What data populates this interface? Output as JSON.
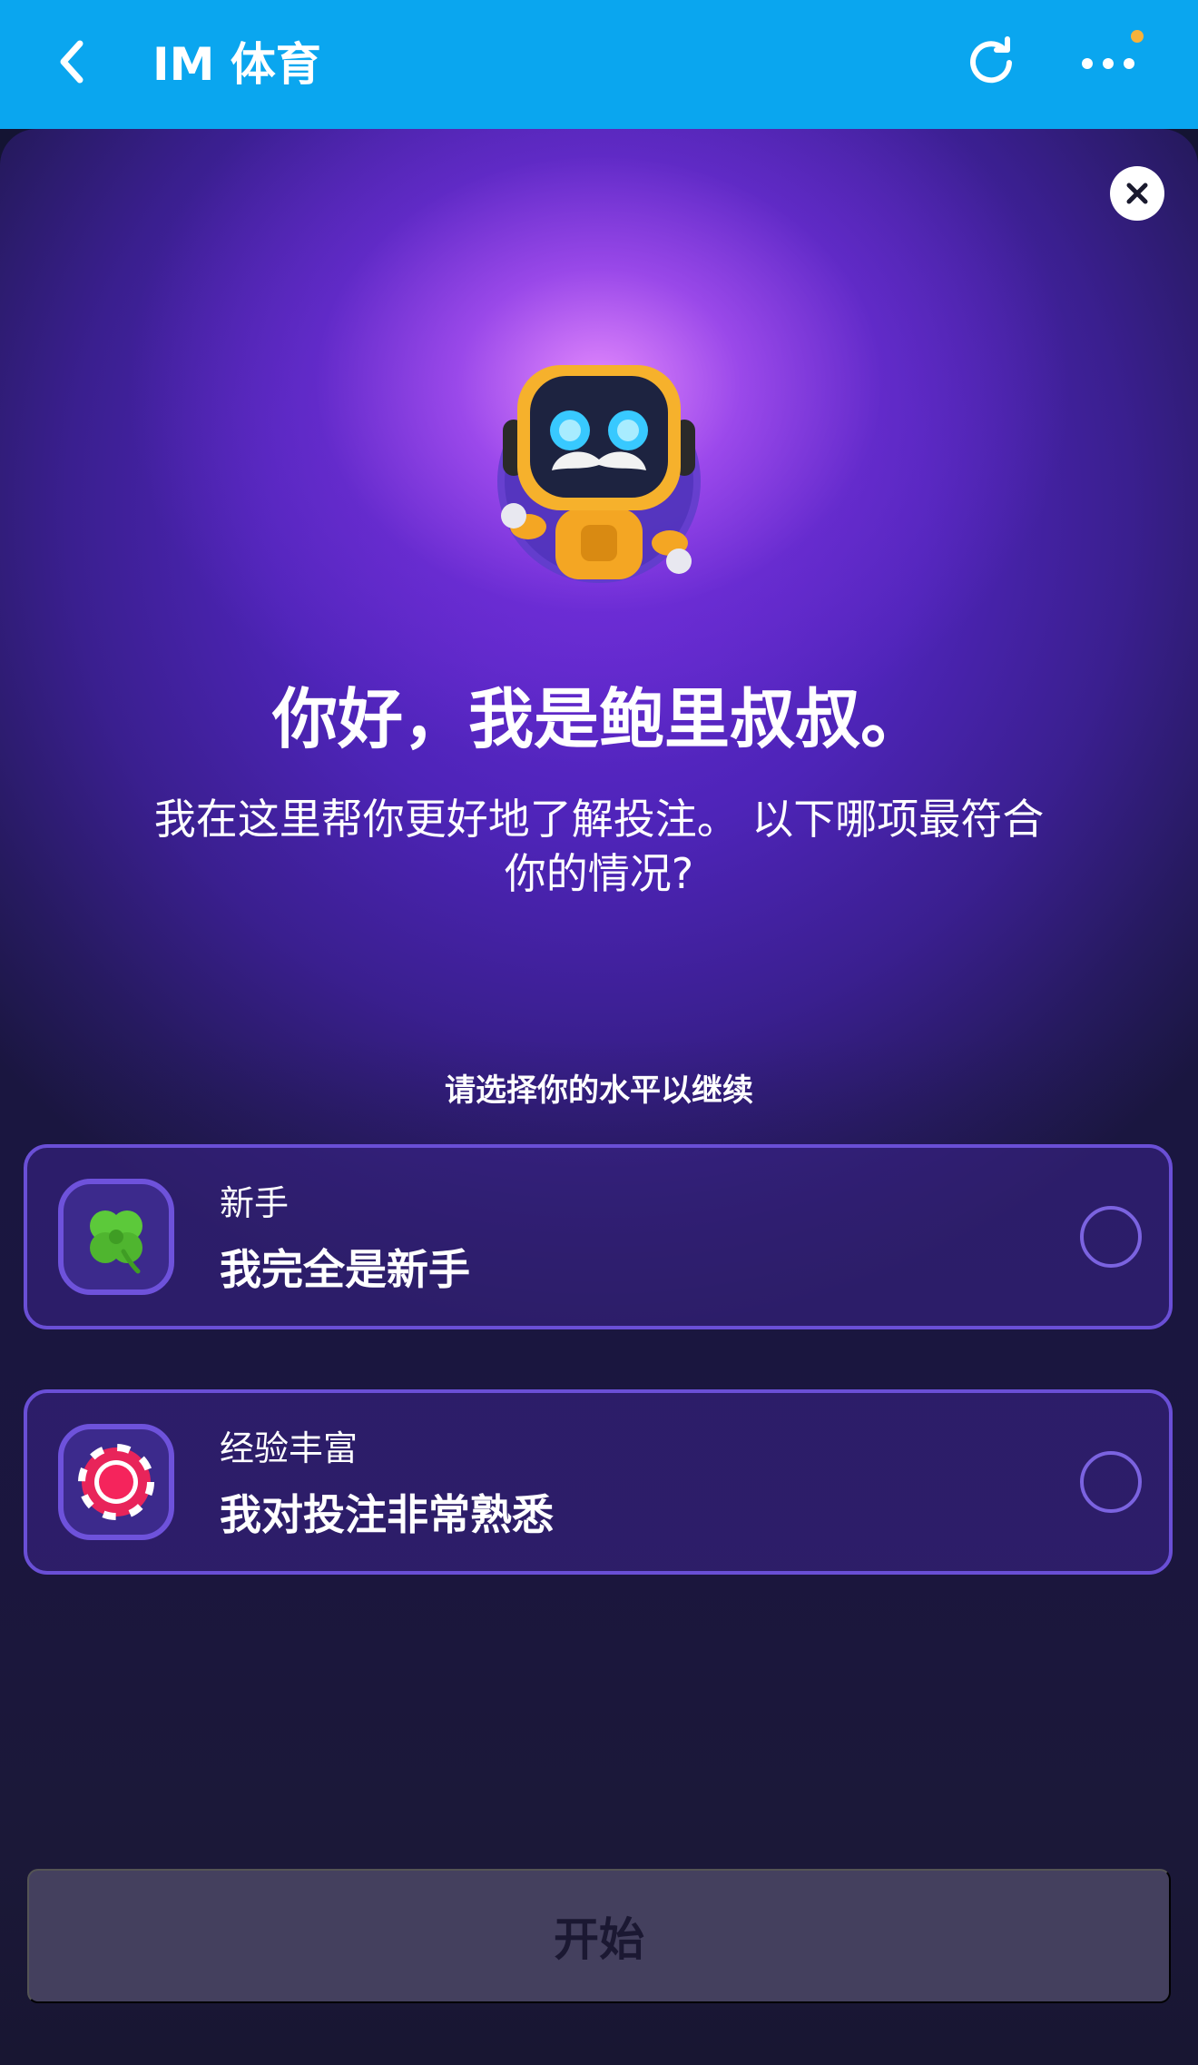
{
  "header": {
    "title": "IM 体育",
    "back_icon": "chevron-left-icon",
    "refresh_icon": "refresh-icon",
    "more_icon": "more-horizontal-icon",
    "bar_color": "#0aa6ef",
    "notification_dot_color": "#f6b23b"
  },
  "modal": {
    "close_icon": "close-icon",
    "mascot": "robot-mascot",
    "greeting": "你好，我是鲍里叔叔。",
    "intro": "我在这里帮你更好地了解投注。 以下哪项最符合你的情况?",
    "prompt": "请选择你的水平以继续",
    "options": [
      {
        "icon": "four-leaf-clover-icon",
        "label": "新手",
        "description": "我完全是新手",
        "selected": false
      },
      {
        "icon": "casino-chip-icon",
        "label": "经验丰富",
        "description": "我对投注非常熟悉",
        "selected": false
      }
    ],
    "start_button": "开始",
    "accent_color": "#6a4fd6"
  }
}
